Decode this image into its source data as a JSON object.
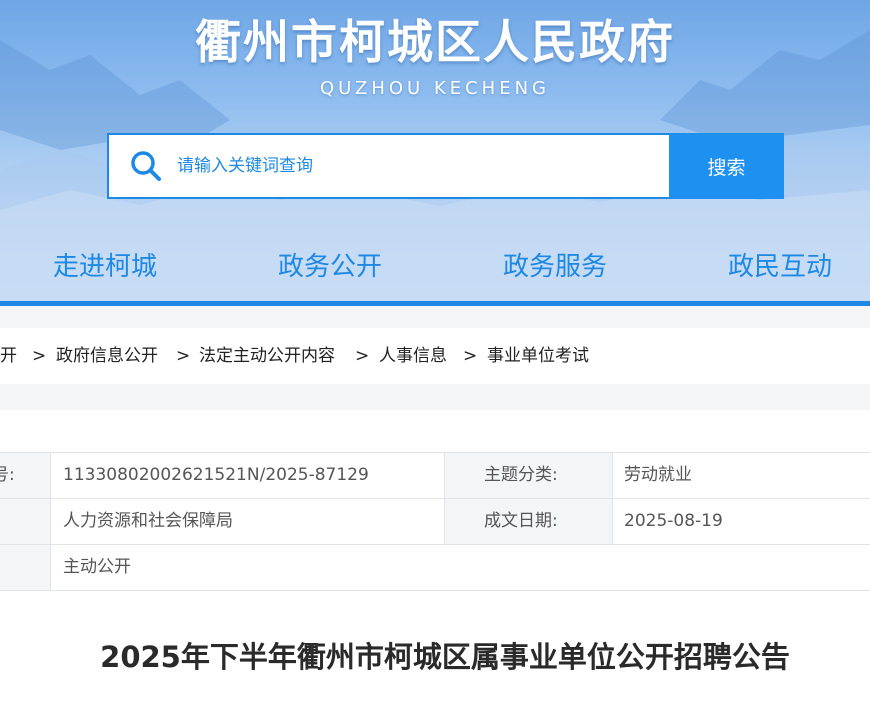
{
  "header": {
    "title": "衢州市柯城区人民政府",
    "subtitle": "QUZHOU KECHENG"
  },
  "search": {
    "placeholder": "请输入关键词查询",
    "button_label": "搜索",
    "icon": "search-icon"
  },
  "nav": {
    "items": [
      {
        "label": "走进柯城"
      },
      {
        "label": "政务公开"
      },
      {
        "label": "政务服务"
      },
      {
        "label": "政民互动"
      }
    ]
  },
  "breadcrumb": {
    "items": [
      "开",
      "政府信息公开",
      "法定主动公开内容",
      "人事信息",
      "事业单位考试"
    ],
    "separator": ">"
  },
  "info": {
    "rows": [
      {
        "label1": "号:",
        "value1": "11330802002621521N/2025-87129",
        "label2": "主题分类:",
        "value2": "劳动就业"
      },
      {
        "label1": "",
        "value1": "人力资源和社会保障局",
        "label2": "成文日期:",
        "value2": "2025-08-19"
      },
      {
        "label1": "",
        "value1": "主动公开"
      }
    ]
  },
  "document": {
    "title": "2025年下半年衢州市柯城区属事业单位公开招聘公告"
  },
  "colors": {
    "accent": "#1e88e5",
    "button": "#1e90f0",
    "label_bg": "#f4f5f7"
  }
}
